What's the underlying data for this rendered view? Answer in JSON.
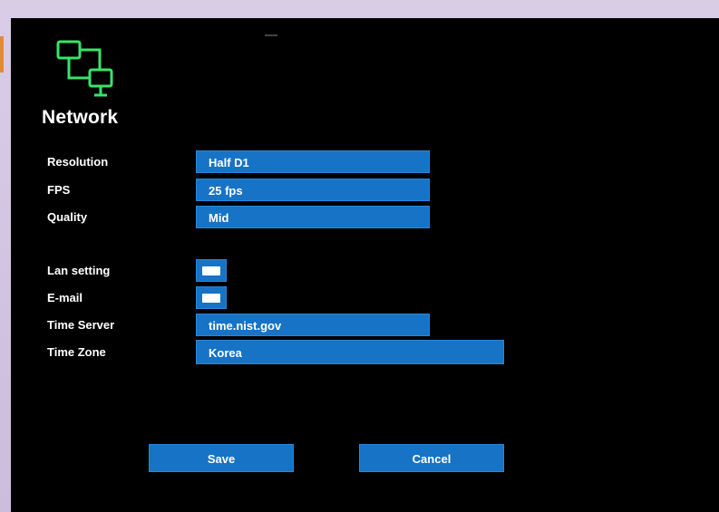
{
  "header": {
    "title": "Network",
    "icon": "network-icon"
  },
  "settings": {
    "resolution": {
      "label": "Resolution",
      "value": "Half D1"
    },
    "fps": {
      "label": "FPS",
      "value": "25 fps"
    },
    "quality": {
      "label": "Quality",
      "value": "Mid"
    },
    "lan_setting": {
      "label": "Lan setting",
      "checked": false
    },
    "email": {
      "label": "E-mail",
      "checked": false
    },
    "time_server": {
      "label": "Time Server",
      "value": "time.nist.gov"
    },
    "time_zone": {
      "label": "Time Zone",
      "value": "Korea"
    }
  },
  "actions": {
    "save_label": "Save",
    "cancel_label": "Cancel"
  },
  "colors": {
    "background": "#000000",
    "field": "#1673c6",
    "icon": "#39e36a",
    "text": "#ffffff"
  }
}
